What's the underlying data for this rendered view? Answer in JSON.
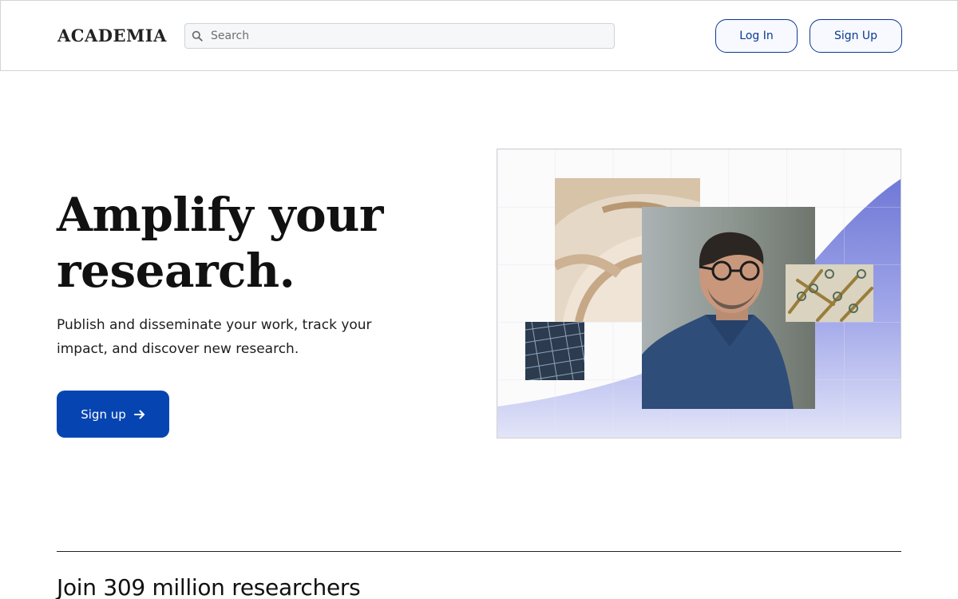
{
  "header": {
    "logo": "ACADEMIA",
    "search": {
      "placeholder": "Search",
      "value": "",
      "icon": "search-icon"
    },
    "login_label": "Log In",
    "signup_label": "Sign Up"
  },
  "hero": {
    "title_line1": "Amplify your",
    "title_line2": "research.",
    "subtitle": "Publish and disseminate your work, track your impact, and discover new research.",
    "cta_label": "Sign up",
    "cta_icon": "arrow-right-icon"
  },
  "collage": {
    "images": [
      "sculpture-image",
      "portrait-image",
      "solar-panel-image",
      "microscopy-image"
    ],
    "accent_color": "#7b83d9"
  },
  "footer": {
    "join_text": "Join 309 million researchers"
  },
  "colors": {
    "brand": "#0645b1",
    "outline_button": "#0a3a8f",
    "text": "#111111"
  }
}
